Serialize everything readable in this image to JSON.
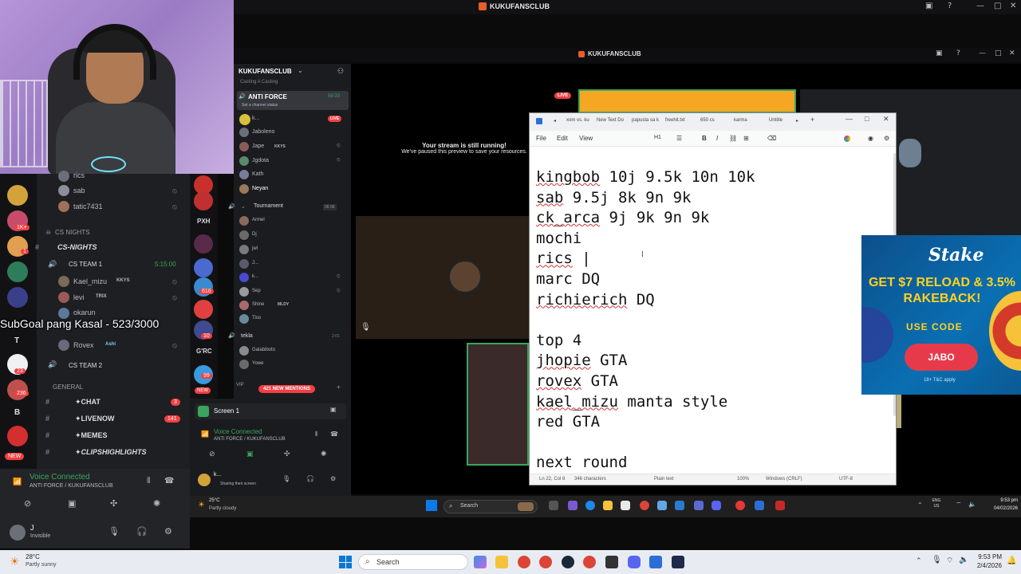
{
  "outer_window": {
    "title": "KUKUFANSCLUB",
    "controls": [
      "—",
      "□",
      "✕"
    ]
  },
  "inner_window": {
    "title": "KUKUFANSCLUB"
  },
  "overlay": {
    "subgoal": "SubGoal pang Kasal - 523/3000"
  },
  "left_pane": {
    "server_badges": [
      "1K+",
      "1",
      "23",
      "236"
    ],
    "server_letters": [
      "T",
      "B"
    ],
    "new_label": "NEW",
    "voice_users_top": [
      "rics",
      "sab",
      "tatic7431"
    ],
    "category_cs_nights": "CS NIGHTS",
    "channel_cs_nights": "CS-NIGHTS",
    "cs_team_1": {
      "name": "CS TEAM 1",
      "timer": "5:15:00"
    },
    "team1_users": [
      {
        "name": "Kael_mizu",
        "tag": "KKYS"
      },
      {
        "name": "levi",
        "tag": "TRIX"
      },
      {
        "name": "okarun",
        "tag": ""
      },
      {
        "name": "Rovex",
        "tag": "Ashi"
      }
    ],
    "cs_team_2": "CS TEAM 2",
    "category_general": "GENERAL",
    "text_channels": [
      {
        "name": "✦CHAT",
        "badge": "3"
      },
      {
        "name": "✦LIVENOW",
        "badge": "141"
      },
      {
        "name": "✦MEMES",
        "badge": ""
      },
      {
        "name": "✦CLIPSHIGHLIGHTS",
        "badge": ""
      }
    ],
    "voice_status": {
      "title": "Voice Connected",
      "subtitle": "ANTI FORCE / KUKUFANSCLUB"
    },
    "user": {
      "name": "J",
      "status": "Invisible"
    }
  },
  "mid_pane": {
    "server_name": "KUKUFANSCLUB",
    "cut_top": "Casting A Casting",
    "channel": "ANTI FORCE",
    "channel_timer": "59:33",
    "set_status": "Set a channel status",
    "live_label": "LIVE",
    "users": [
      {
        "name": "k...",
        "tag": ""
      },
      {
        "name": "Jaboleno",
        "tag": ""
      },
      {
        "name": "Jape",
        "tag": "KKYS"
      },
      {
        "name": "Jgdota",
        "tag": ""
      },
      {
        "name": "Kath",
        "tag": ""
      },
      {
        "name": "Neyan",
        "tag": ""
      }
    ],
    "tournament": {
      "name": "Tournament",
      "count": "06 06"
    },
    "tournament_users": [
      "Armel",
      "Dj",
      "jwl",
      "J...",
      "k...",
      "Sep",
      "Shine",
      "Tiso"
    ],
    "shine_tag": "MLDY",
    "tekla": {
      "name": "tekla",
      "timer": "2:01"
    },
    "tekla_users": [
      "Galabiboto",
      "Yowe"
    ],
    "rail_labels": [
      "PXH",
      "G'RC"
    ],
    "rail_badges": [
      "616",
      "10",
      "99"
    ],
    "vip_label": "VIP",
    "mentions_pill": "421 NEW MENTIONS",
    "screen_label": "Screen 1",
    "voice_status": {
      "title": "Voice Connected",
      "subtitle": "ANTI FORCE / KUKUFANSCLUB"
    },
    "user": {
      "name": "k...",
      "status": "Sharing their screen"
    }
  },
  "stage": {
    "live_badge": "LIVE",
    "paused_title": "Your stream is still running!",
    "paused_sub": "We've paused this preview to save your resources."
  },
  "notepad": {
    "tabs": [
      "xom vs. ku",
      "New Text Do",
      "papusta sa k",
      "freehit.txt",
      "650 cs",
      "karma",
      "Untitle"
    ],
    "menu": [
      "File",
      "Edit",
      "View"
    ],
    "heading_menu": "H1",
    "lines": [
      {
        "underlined": "kingbob",
        "rest": " 10j 9.5k 10n 10k"
      },
      {
        "underlined": "sab",
        "rest": " 9.5j 8k 9n 9k"
      },
      {
        "underlined": "ck_arca",
        "rest": " 9j 9k 9n 9k"
      },
      {
        "underlined": "",
        "rest": "mochi"
      },
      {
        "underlined": "rics",
        "rest": " |"
      },
      {
        "underlined": "",
        "rest": "marc DQ"
      },
      {
        "underlined": "richierich",
        "rest": " DQ"
      },
      {
        "underlined": "",
        "rest": ""
      },
      {
        "underlined": "",
        "rest": "top 4"
      },
      {
        "underlined": "jhopie",
        "rest": " GTA"
      },
      {
        "underlined": "rovex",
        "rest": " GTA"
      },
      {
        "underlined": "kael_mizu",
        "rest": " manta style"
      },
      {
        "underlined": "",
        "rest": "red GTA"
      },
      {
        "underlined": "",
        "rest": ""
      },
      {
        "underlined": "",
        "rest": "next round"
      }
    ],
    "status": {
      "pos": "Ln 22, Col 8",
      "chars": "346 characters",
      "fmt": "Plain text",
      "zoom": "100%",
      "eol": "Windows (CRLF)",
      "enc": "UTF-8"
    }
  },
  "stake_ad": {
    "logo": "Stake",
    "headline": "GET $7 RELOAD & 3.5% RAKEBACK!",
    "use_code": "USE CODE",
    "code": "JABO",
    "tc": "18+ T&C apply"
  },
  "inner_taskbar": {
    "weather_temp": "25°C",
    "weather_desc": "Partly cloudy",
    "search": "Search",
    "lang": "ENG US",
    "time": "9:53 pm",
    "date": "04/02/2026"
  },
  "taskbar": {
    "weather_temp": "28°C",
    "weather_desc": "Partly sunny",
    "search": "Search",
    "time": "9:53 PM",
    "date": "2/4/2026"
  }
}
